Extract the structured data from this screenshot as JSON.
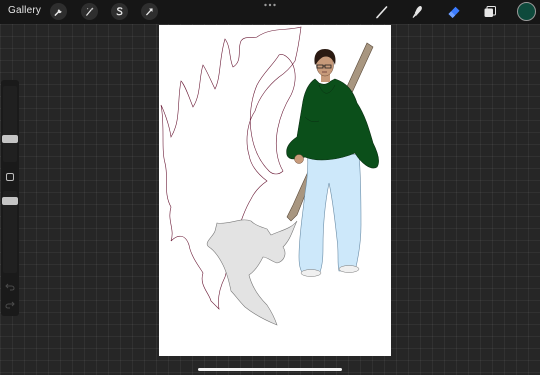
{
  "topbar": {
    "gallery_label": "Gallery",
    "tools_left": [
      {
        "name": "actions",
        "icon": "wrench-icon"
      },
      {
        "name": "adjustments",
        "icon": "magic-wand-icon"
      },
      {
        "name": "selection",
        "icon": "selection-s-icon"
      },
      {
        "name": "transform",
        "icon": "arrow-cursor-icon"
      }
    ],
    "tools_right": [
      {
        "name": "brush",
        "icon": "brush-icon"
      },
      {
        "name": "smudge",
        "icon": "smudge-icon"
      },
      {
        "name": "eraser",
        "icon": "eraser-icon",
        "active": true
      },
      {
        "name": "layers",
        "icon": "layers-icon"
      }
    ],
    "active_color": "#0e4a3c"
  },
  "sidebar": {
    "brush_size_level": 0.55,
    "opacity_level": 0.9
  },
  "colors": {
    "topbar_bg": "#161616",
    "workspace_bg": "#262626",
    "accent_blue": "#3a7bff",
    "canvas_bg": "#ffffff"
  }
}
